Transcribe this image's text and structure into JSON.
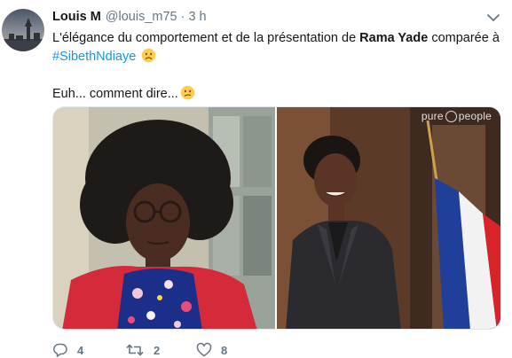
{
  "author": {
    "name": "Louis M",
    "handle": "@louis_m75",
    "separator": "·",
    "time": "3 h"
  },
  "tweet": {
    "line1_prefix": "L'élégance du comportement et de la présentation de ",
    "line1_bold": "Rama Yade",
    "line1_suffix": " comparée à",
    "hashtag": "#SibethNdiaye",
    "line3": "Euh... comment dire..."
  },
  "media": {
    "watermark_left": "pure",
    "watermark_right": "people"
  },
  "actions": {
    "reply_count": "4",
    "retweet_count": "2",
    "like_count": "8"
  },
  "colors": {
    "text": "#14171a",
    "secondary": "#657786",
    "link": "#1b95e0"
  },
  "icons": {
    "avatar": "avatar-photo",
    "menu": "chevron-down-icon",
    "reply": "reply-icon",
    "retweet": "retweet-icon",
    "like": "heart-icon"
  }
}
